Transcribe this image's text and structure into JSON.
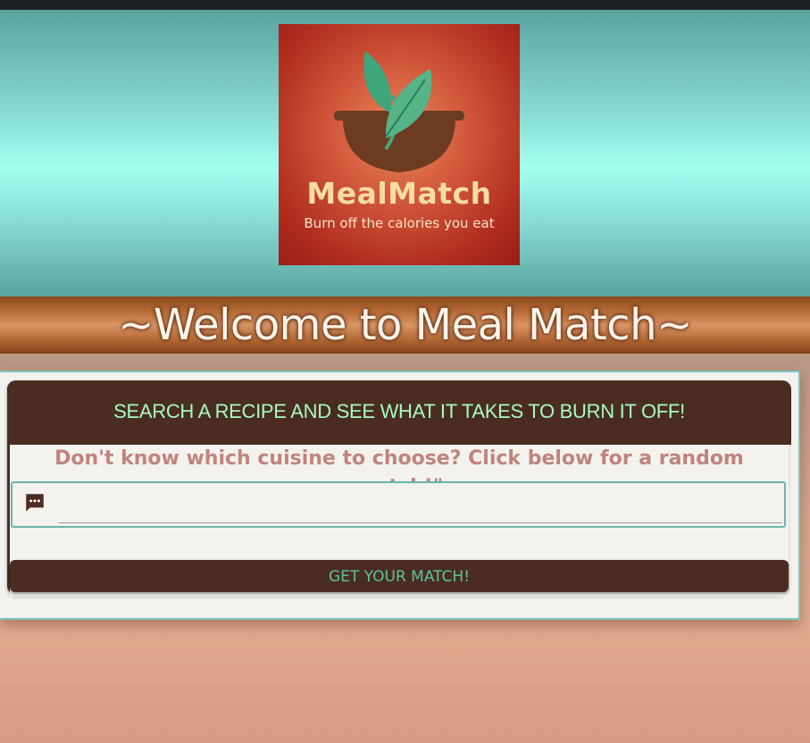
{
  "logo": {
    "title": "MealMatch",
    "tagline": "Burn off the calories you eat"
  },
  "banner": {
    "title": "~Welcome to Meal Match~"
  },
  "search_card": {
    "header": "SEARCH A RECIPE AND SEE WHAT IT TAKES TO BURN IT OFF!",
    "hint": "Don't know which cuisine to choose? Click below for a random match!\"",
    "input_value": "",
    "input_icon": "chat-icon",
    "button_label": "GET YOUR MATCH!"
  },
  "colors": {
    "hero_teal": "#a4fff0",
    "banner_brown": "#b56a36",
    "card_brown": "#4a2c22",
    "header_text_green": "#a6fbc2",
    "hint_text": "#c0847c",
    "button_text": "#5fc49a",
    "logo_red": "#b02e20",
    "logo_cream": "#f7dda2"
  }
}
